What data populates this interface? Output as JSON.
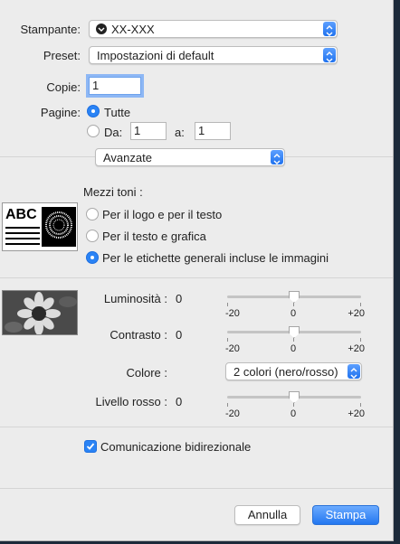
{
  "printer": {
    "label": "Stampante:",
    "value": "XX-XXX",
    "icon": "printer-icon"
  },
  "preset": {
    "label": "Preset:",
    "value": "Impostazioni di default"
  },
  "copies": {
    "label": "Copie:",
    "value": "1"
  },
  "pages": {
    "label": "Pagine:",
    "all_label": "Tutte",
    "from_label": "Da:",
    "from_value": "1",
    "to_label": "a:",
    "to_value": "1",
    "selected": "all"
  },
  "section_popup": {
    "value": "Avanzate"
  },
  "halftone": {
    "title": "Mezzi toni :",
    "preview_text": "ABC",
    "options": [
      {
        "label": "Per il logo e per il testo",
        "selected": false
      },
      {
        "label": "Per il testo e grafica",
        "selected": false
      },
      {
        "label": "Per le etichette generali incluse le immagini",
        "selected": true
      }
    ]
  },
  "brightness": {
    "label": "Luminosità :",
    "value": "0",
    "min_label": "-20",
    "mid_label": "0",
    "max_label": "+20",
    "level": 0.5
  },
  "contrast": {
    "label": "Contrasto :",
    "value": "0",
    "min_label": "-20",
    "mid_label": "0",
    "max_label": "+20",
    "level": 0.5
  },
  "color": {
    "label": "Colore :",
    "value": "2 colori (nero/rosso)"
  },
  "red_level": {
    "label": "Livello rosso :",
    "value": "0",
    "min_label": "-20",
    "mid_label": "0",
    "max_label": "+20",
    "level": 0.5
  },
  "bidirectional": {
    "label": "Comunicazione bidirezionale",
    "checked": true
  },
  "buttons": {
    "cancel": "Annulla",
    "print": "Stampa"
  },
  "colors": {
    "accent": "#2a83f5",
    "background": "#ececec"
  }
}
